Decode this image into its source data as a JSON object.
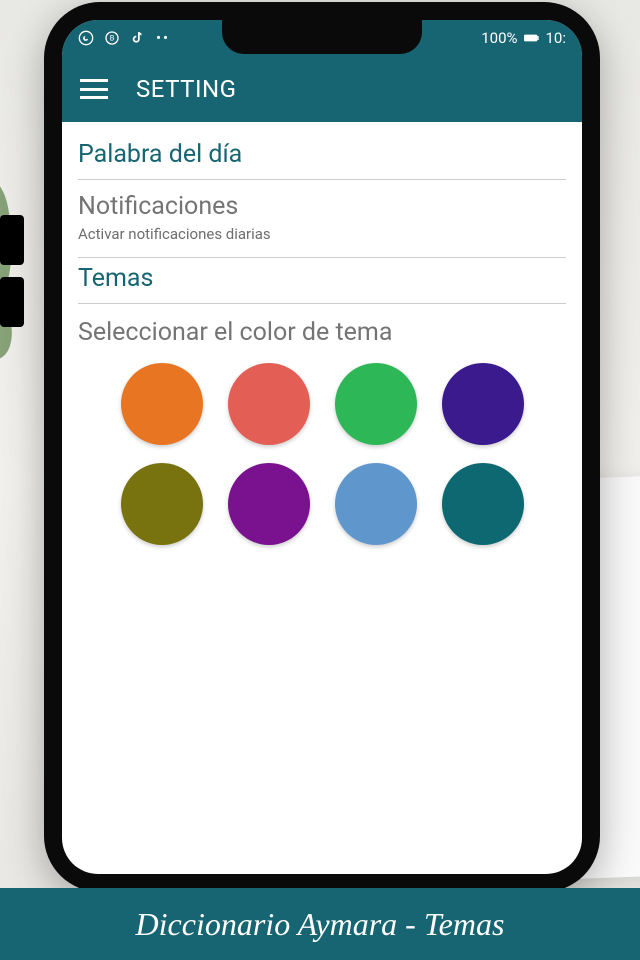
{
  "status": {
    "battery_pct": "100%",
    "time": "10:"
  },
  "appbar": {
    "title": "SETTING"
  },
  "sections": {
    "word_of_day": "Palabra del día",
    "notifications_title": "Notificaciones",
    "notifications_sub": "Activar notificaciones diarias",
    "themes": "Temas",
    "theme_select": "Seleccionar el color de tema"
  },
  "swatches": [
    {
      "name": "orange",
      "color": "#e87522"
    },
    {
      "name": "coral",
      "color": "#e35e54"
    },
    {
      "name": "green",
      "color": "#2eb756"
    },
    {
      "name": "indigo",
      "color": "#3a1a8c"
    },
    {
      "name": "olive",
      "color": "#78720f"
    },
    {
      "name": "purple",
      "color": "#7a118e"
    },
    {
      "name": "blue",
      "color": "#5f97cd"
    },
    {
      "name": "teal",
      "color": "#0d6872"
    }
  ],
  "banner": "Diccionario Aymara - Temas"
}
